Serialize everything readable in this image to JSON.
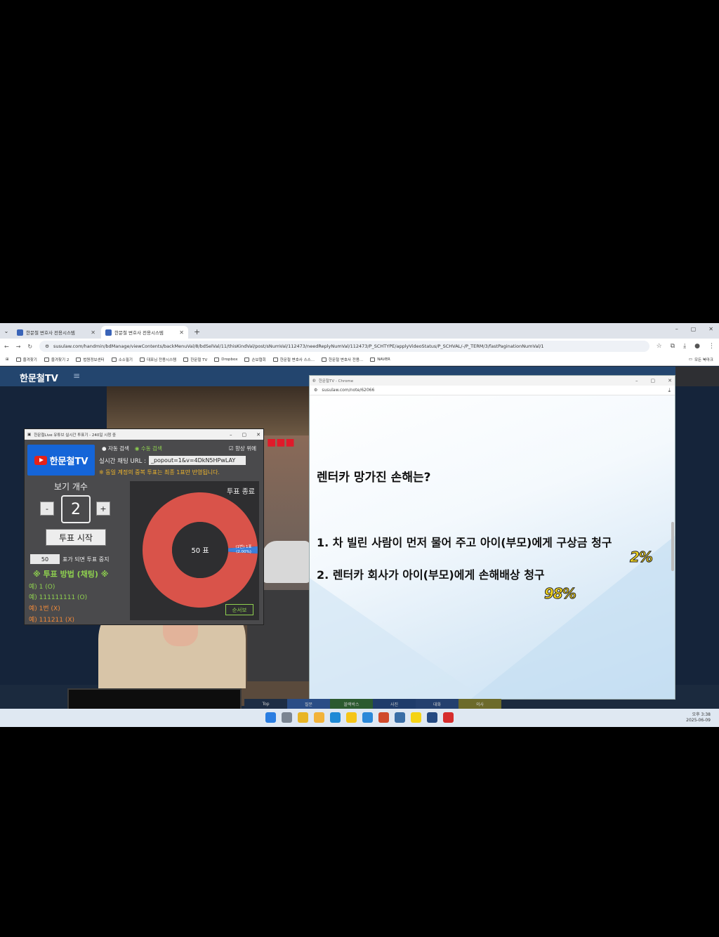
{
  "browser": {
    "tabs": [
      {
        "title": "한문철 변호사 전용시스템"
      },
      {
        "title": "한문철 변호사 전용시스템"
      }
    ],
    "url": "susulaw.com/handmin/bdManage/viewContents/backMenuVal/8/bdSelVal/11/thisKindVal/post/sNumVal/112473/needReplyNumVal/112473/P_SCHTYPE/applyVideoStatus/P_SCHVAL/-/P_TERM/3/fastPaginationNumVal/1",
    "bookmarks": [
      "즐겨찾기",
      "즐겨찾기 2",
      "법원정보센터",
      "소소필기",
      "대표님 전용시스템",
      "한문철 TV",
      "Dropbox",
      "손보협회",
      "한문철 변호사 스스...",
      "한문철 변호사 전용...",
      "NAVER"
    ],
    "bookmarks_right": "모든 북마크"
  },
  "site": {
    "logo": "한문철TV",
    "menu_icon": "≡"
  },
  "vote_window": {
    "title": "한문철Live 유튜브 실시간 투표기 - 240일 시청 중",
    "logo_text": "한문철TV",
    "auto_search": "자동 검색",
    "manual_search": "수동 검색",
    "always_on_top": "항상 위에",
    "chat_url_label": "실시간 채팅 URL :",
    "chat_url_value": "_popout=1&v=4DkN5HPwLAY",
    "duplicate_note": "※ 동일 계정의 중복 투표는 최종 1표만 반영됩니다.",
    "view_count_label": "보기 개수",
    "minus": "-",
    "count": "2",
    "plus": "+",
    "start_button": "투표 시작",
    "stop_value": "50",
    "stop_label": "표가 되면 투표 중지",
    "method_title": "※ 투표 방법 (채팅) ※",
    "examples": [
      {
        "text": "예) 1 (O)",
        "ok": true
      },
      {
        "text": "예) 111111111 (O)",
        "ok": true
      },
      {
        "text": "예) 1번 (X)",
        "ok": false
      },
      {
        "text": "예) 111211 (X)",
        "ok": false
      }
    ],
    "vote_end": "투표 종료",
    "result_button": "순서보"
  },
  "chart_data": {
    "type": "pie",
    "center_label": "50 표",
    "slices": [
      {
        "label": "(2번)",
        "value": 49,
        "color": "#d9534a"
      },
      {
        "label": "(1번) 1표 (2.00%)",
        "value": 1,
        "color": "#3d7fd9"
      }
    ]
  },
  "slide_window": {
    "title": "한문철TV - Chrome",
    "url": "susulaw.com/note/62066",
    "question": "렌터카 망가진 손해는?",
    "options": [
      {
        "text": "1. 차 빌린 사람이 먼저 물어 주고 아이(부모)에게 구상금 청구",
        "percent": "2%"
      },
      {
        "text": "2. 렌터카 회사가 아이(부모)에게 손해배상 청구",
        "percent": "98%"
      }
    ]
  },
  "nav_strip": [
    "Top",
    "질문",
    "블랙박스",
    "사진",
    "대화",
    "의사"
  ],
  "taskbar": {
    "time": "오후 3:38",
    "date": "2025-06-09"
  }
}
